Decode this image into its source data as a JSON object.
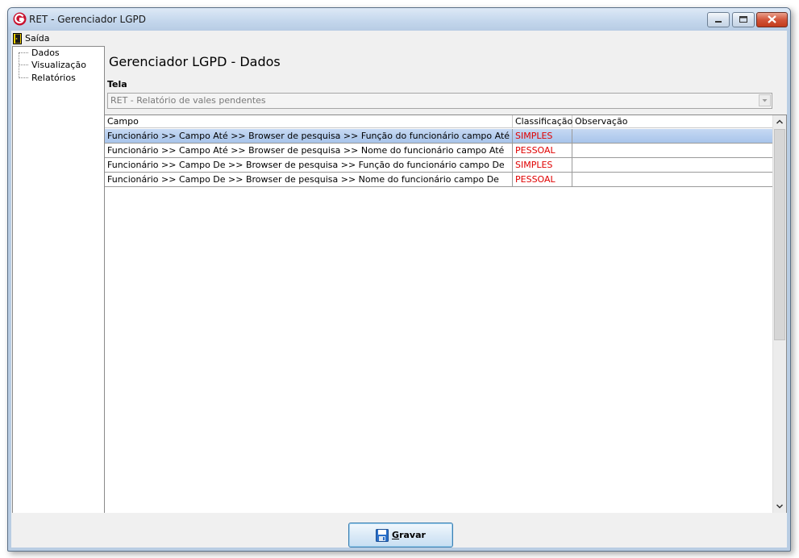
{
  "window": {
    "title": "RET - Gerenciador LGPD"
  },
  "menu": {
    "exit_label": "Saída"
  },
  "tree": {
    "items": [
      {
        "label": "Dados"
      },
      {
        "label": "Visualização"
      },
      {
        "label": "Relatórios"
      }
    ]
  },
  "page": {
    "title": "Gerenciador LGPD - Dados",
    "tela_label": "Tela",
    "tela_value": "RET - Relatório de vales pendentes"
  },
  "grid": {
    "columns": [
      "Campo",
      "Classificação",
      "Observação"
    ],
    "rows": [
      {
        "campo": "Funcionário >> Campo Até >> Browser de pesquisa >> Função do funcionário campo Até",
        "classificacao": "SIMPLES",
        "observacao": ""
      },
      {
        "campo": "Funcionário >> Campo Até >> Browser de pesquisa >> Nome do funcionário campo Até",
        "classificacao": "PESSOAL",
        "observacao": ""
      },
      {
        "campo": "Funcionário >> Campo De >> Browser de pesquisa >> Função do funcionário campo De",
        "classificacao": "SIMPLES",
        "observacao": ""
      },
      {
        "campo": "Funcionário >> Campo De >> Browser de pesquisa >> Nome do funcionário campo De",
        "classificacao": "PESSOAL",
        "observacao": ""
      }
    ]
  },
  "footer": {
    "save_first_letter": "G",
    "save_rest": "ravar"
  },
  "colors": {
    "classification": "#e00000",
    "selected_row": "#b7cfef"
  }
}
